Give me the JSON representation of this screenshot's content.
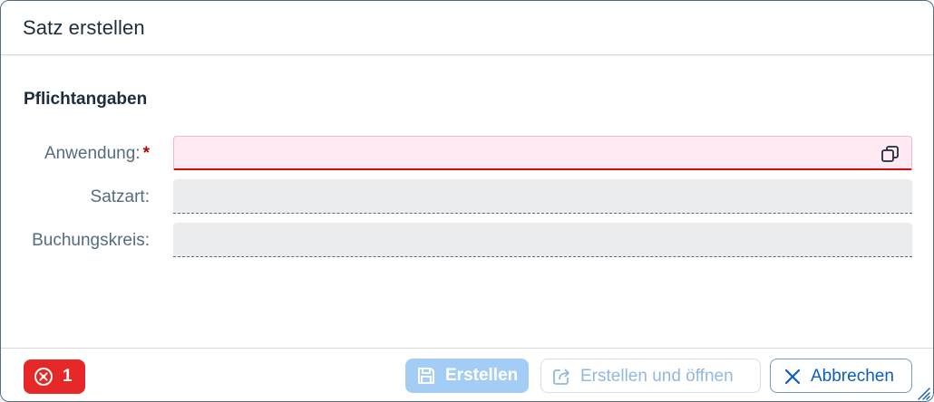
{
  "dialog": {
    "title": "Satz erstellen"
  },
  "section": {
    "title": "Pflichtangaben"
  },
  "fields": {
    "anwendung": {
      "label": "Anwendung:",
      "required_marker": "*",
      "value": "",
      "state": "error"
    },
    "satzart": {
      "label": "Satzart:",
      "value": "",
      "state": "read-only"
    },
    "buchungskreis": {
      "label": "Buchungskreis:",
      "value": "",
      "state": "read-only"
    }
  },
  "footer": {
    "error_count": "1",
    "create_label": "Erstellen",
    "create_open_label": "Erstellen und öffnen",
    "cancel_label": "Abbrechen"
  },
  "icons": {
    "value_help": "value-help-icon",
    "error": "error-circle-icon",
    "save": "save-icon",
    "open_external": "open-external-icon",
    "close": "close-icon"
  },
  "colors": {
    "error": "#e62828",
    "accent": "#0b5eb8",
    "disabled_button": "#a3cdf5",
    "required": "#aa0808"
  }
}
